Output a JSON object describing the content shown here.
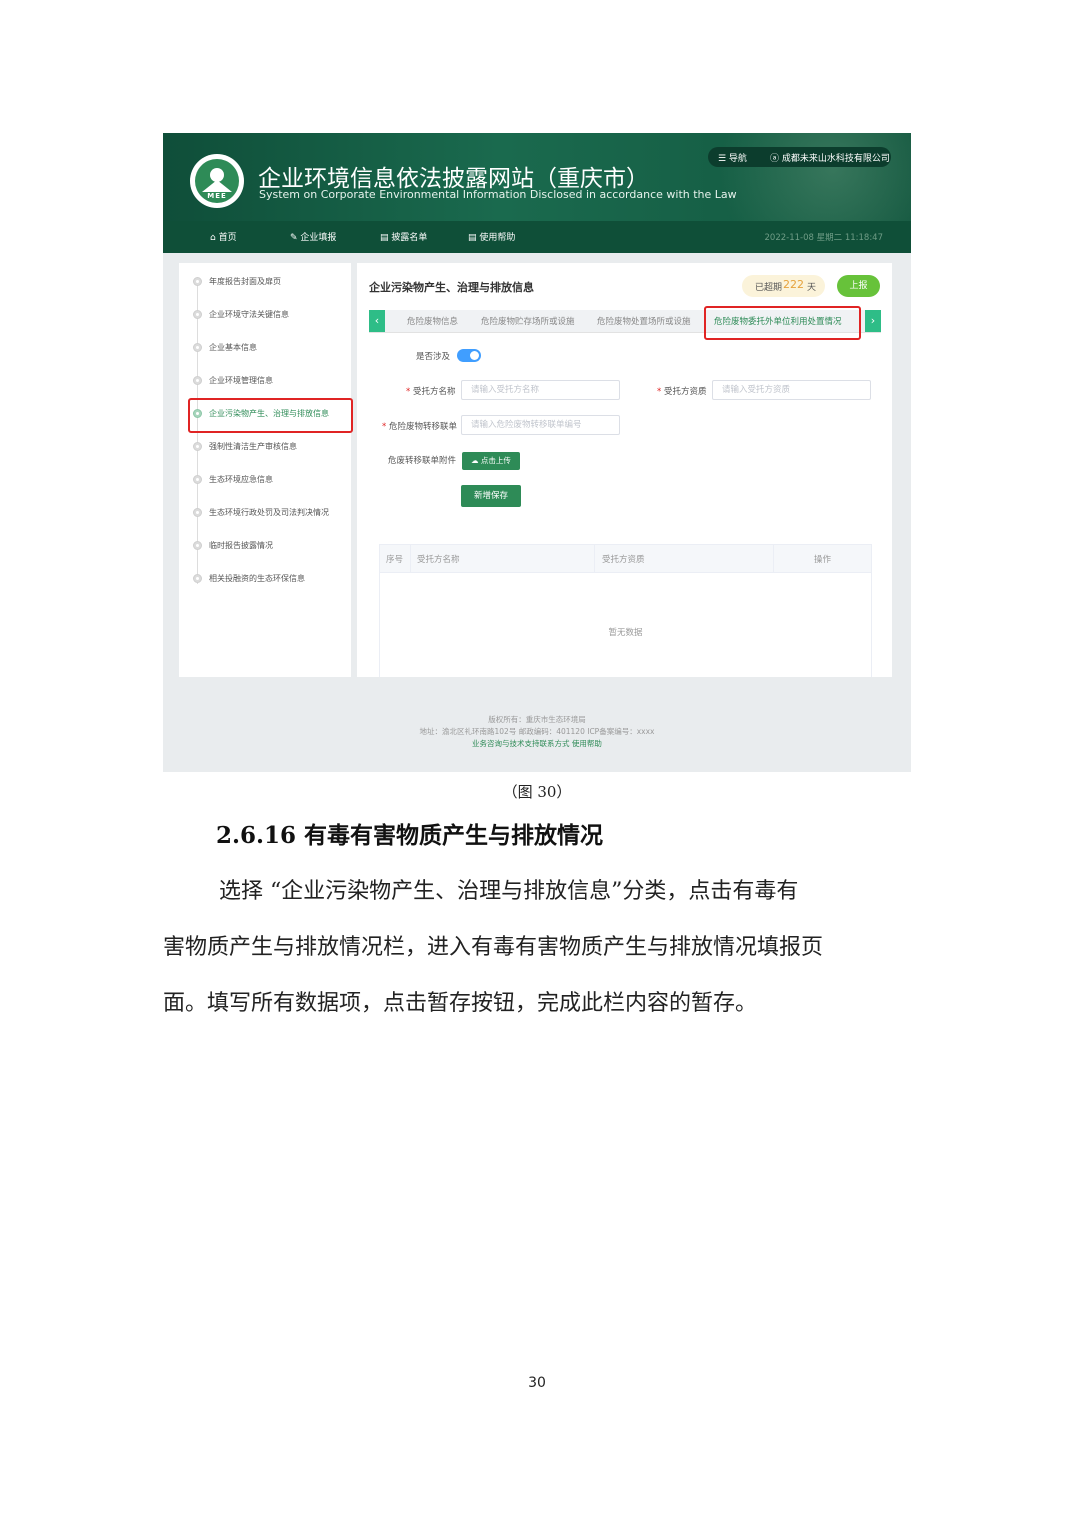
{
  "site": {
    "title": "企业环境信息依法披露网站（重庆市）",
    "subtitle": "System on Corporate Environmental Information Disclosed in accordance with the Law",
    "logo_text": "MEE",
    "nav_label": "☰ 导航",
    "user": "ⓐ 成都未来山水科技有限公司"
  },
  "nav": {
    "items": [
      "首页",
      "企业填报",
      "披露名单",
      "使用帮助"
    ],
    "datetime": "2022-11-08  星期二  11:18:47"
  },
  "sidebar": {
    "items": [
      "年度报告封面及扉页",
      "企业环境守法关键信息",
      "企业基本信息",
      "企业环境管理信息",
      "企业污染物产生、治理与排放信息",
      "强制性清洁生产审核信息",
      "生态环境应急信息",
      "生态环境行政处罚及司法判决情况",
      "临时报告披露情况",
      "相关投融资的生态环保信息"
    ],
    "active_index": 4
  },
  "main": {
    "title": "企业污染物产生、治理与排放信息",
    "overdue_prefix": "已超期",
    "overdue_days": "222",
    "overdue_suffix": "天",
    "report_button": "上报",
    "tabs": [
      "危险废物信息",
      "危险废物贮存场所或设施",
      "危险废物处置场所或设施",
      "危险废物委托外单位利用处置情况"
    ],
    "active_tab": 3,
    "tab_prev": "‹",
    "tab_next": "›"
  },
  "form": {
    "involved_label": "是否涉及",
    "involved": true,
    "entrusted_name_label": "受托方名称",
    "entrusted_name_placeholder": "请输入受托方名称",
    "entrusted_qual_label": "受托方资质",
    "entrusted_qual_placeholder": "请输入受托方资质",
    "transfer_form_label": "危险废物转移联单",
    "transfer_form_placeholder": "请输入危险废物转移联单编号",
    "attachment_label": "危废转移联单附件",
    "upload_button": "☁ 点击上传",
    "save_button": "新增保存"
  },
  "table": {
    "headers": [
      "序号",
      "受托方名称",
      "受托方资质",
      "操作"
    ],
    "empty_text": "暂无数据"
  },
  "footer": {
    "copyright": "版权所有：重庆市生态环境局",
    "address": "地址：渝北区礼环南路102号      邮政编码：401120      ICP备案编号：xxxx",
    "links": "业务咨询与技术支持联系方式      使用帮助"
  },
  "doc": {
    "caption": "（图 30）",
    "heading": "2.6.16 有毒有害物质产生与排放情况",
    "paragraph_lines": [
      "        选择 “企业污染物产生、治理与排放信息”分类，点击有毒有",
      "害物质产生与排放情况栏，进入有毒有害物质产生与排放情况填报页",
      "面。填写所有数据项，点击暂存按钮，完成此栏内容的暂存。"
    ],
    "page_number": "30"
  },
  "colors": {
    "brand_green": "#2e8b57",
    "banner_green": "#0f4e39",
    "highlight_red": "#e02424",
    "toggle_blue": "#409eff",
    "report_green": "#67c23a"
  }
}
